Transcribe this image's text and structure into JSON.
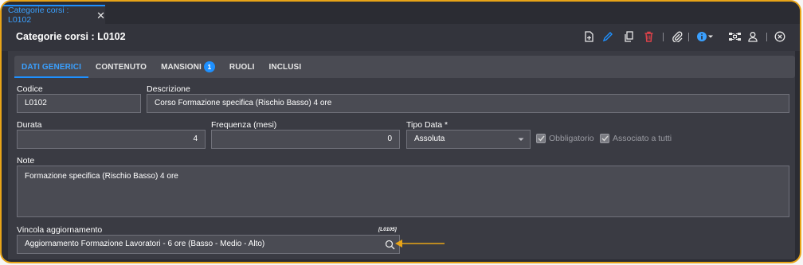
{
  "tab": {
    "title": "Categorie corsi : L0102",
    "close_glyph": "✕"
  },
  "header": {
    "title": "Categorie corsi : L0102"
  },
  "toolbar": {
    "icons": [
      "new-document-icon",
      "edit-icon",
      "copy-icon",
      "delete-icon",
      "attachment-icon",
      "info-icon",
      "dropdown-caret-icon",
      "network-icon",
      "user-icon",
      "close-circle-icon"
    ],
    "colors": {
      "edit": "#1e90ff",
      "delete": "#e0424a",
      "info": "#3aa0ff"
    }
  },
  "form_tabs": [
    {
      "label": "DATI GENERICI",
      "active": true
    },
    {
      "label": "CONTENUTO"
    },
    {
      "label": "MANSIONI",
      "badge": "1"
    },
    {
      "label": "RUOLI"
    },
    {
      "label": "INCLUSI"
    }
  ],
  "fields": {
    "codice": {
      "label": "Codice",
      "value": "L0102"
    },
    "descrizione": {
      "label": "Descrizione",
      "value": "Corso Formazione specifica (Rischio Basso) 4 ore"
    },
    "durata": {
      "label": "Durata",
      "value": "4"
    },
    "frequenza": {
      "label": "Frequenza (mesi)",
      "value": "0"
    },
    "tipo_data": {
      "label": "Tipo Data *",
      "value": "Assoluta"
    },
    "obbligatorio": {
      "label": "Obbligatorio",
      "checked": true
    },
    "associato": {
      "label": "Associato a tutti",
      "checked": true
    },
    "note": {
      "label": "Note",
      "value": "Formazione specifica (Rischio Basso) 4 ore"
    },
    "vincola": {
      "label": "Vincola aggiornamento",
      "code": "[L0105]",
      "value": "Aggiornamento Formazione Lavoratori - 6 ore (Basso - Medio - Alto)"
    }
  },
  "accent": {
    "frame_border": "#e8a418",
    "arrow": "#e8a418",
    "primary": "#1e90ff"
  }
}
